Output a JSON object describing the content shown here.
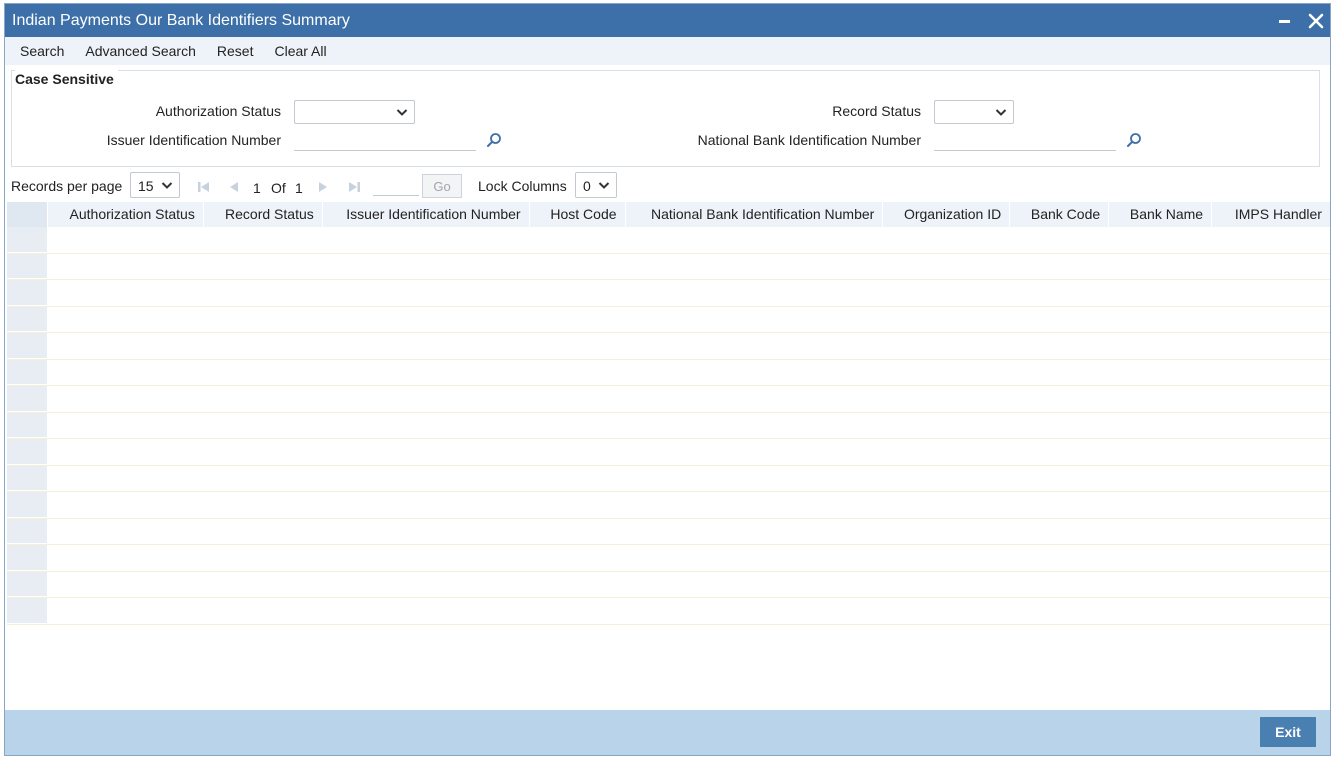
{
  "window": {
    "title": "Indian Payments Our Bank Identifiers Summary"
  },
  "menu": {
    "items": [
      "Search",
      "Advanced Search",
      "Reset",
      "Clear All"
    ]
  },
  "criteria": {
    "legend": "Case Sensitive",
    "authorization_status_label": "Authorization Status",
    "authorization_status_value": "",
    "record_status_label": "Record Status",
    "record_status_value": "",
    "issuer_id_label": "Issuer Identification Number",
    "issuer_id_value": "",
    "nbin_label": "National Bank Identification Number",
    "nbin_value": ""
  },
  "pager": {
    "records_per_page_label": "Records per page",
    "records_per_page_value": "15",
    "current_page": "1",
    "of_label": "Of",
    "total_pages": "1",
    "go_label": "Go",
    "lock_columns_label": "Lock Columns",
    "lock_columns_value": "0"
  },
  "grid": {
    "columns": [
      "Authorization Status",
      "Record Status",
      "Issuer Identification Number",
      "Host Code",
      "National Bank Identification Number",
      "Organization ID",
      "Bank Code",
      "Bank Name",
      "IMPS Handler"
    ],
    "empty_rows": 15
  },
  "footer": {
    "exit_label": "Exit"
  },
  "colors": {
    "titlebar": "#3d6fa8",
    "menubar": "#eef3f9",
    "footer": "#b8d3ea",
    "exit_button": "#4a7fb2"
  }
}
